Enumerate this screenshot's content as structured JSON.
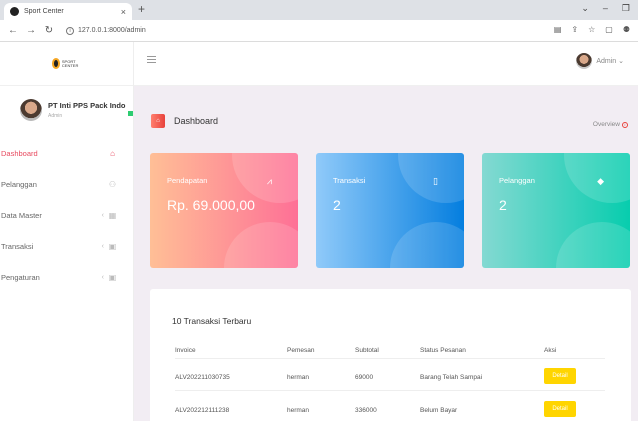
{
  "browser": {
    "tab_title": "Sport Center",
    "url": "127.0.0.1:8000/admin",
    "new_tab": "+",
    "tab_close": "×"
  },
  "sidebar": {
    "logo_text": "SPORT CENTER",
    "user_name": "PT Inti PPS Pack Indo",
    "user_role": "Admin",
    "items": [
      {
        "label": "Dashboard",
        "icon": "home-icon",
        "glyph": "⌂",
        "active": true
      },
      {
        "label": "Pelanggan",
        "icon": "users-icon",
        "glyph": "⚇",
        "active": false
      },
      {
        "label": "Data Master",
        "icon": "grid-icon",
        "glyph": "▦",
        "active": false
      },
      {
        "label": "Transaksi",
        "icon": "lock-icon",
        "glyph": "▣",
        "active": false
      },
      {
        "label": "Pengaturan",
        "icon": "lock-icon",
        "glyph": "▣",
        "active": false
      }
    ]
  },
  "topbar": {
    "admin_label": "Admin ⌄"
  },
  "page": {
    "title": "Dashboard",
    "overview": "Overview"
  },
  "cards": [
    {
      "label": "Pendapatan",
      "value": "Rp. 69.000,00",
      "icon": "chart-line-icon",
      "color_from": "#ffbf96",
      "color_to": "#fe7096"
    },
    {
      "label": "Transaksi",
      "value": "2",
      "icon": "bookmark-icon",
      "color_from": "#90caf9",
      "color_to": "#047edf"
    },
    {
      "label": "Pelanggan",
      "value": "2",
      "icon": "diamond-icon",
      "color_from": "#84d9d2",
      "color_to": "#07cdae"
    }
  ],
  "table": {
    "title": "10 Transaksi Terbaru",
    "headers": [
      "Invoice",
      "Pemesan",
      "Subtotal",
      "Status Pesanan",
      "Aksi"
    ],
    "rows": [
      {
        "invoice": "ALV202211030735",
        "pemesan": "herman",
        "subtotal": "69000",
        "status": "Barang Telah Sampai",
        "aksi": "Detail"
      },
      {
        "invoice": "ALV202212111238",
        "pemesan": "herman",
        "subtotal": "336000",
        "status": "Belum Bayar",
        "aksi": "Detail"
      }
    ]
  },
  "colors": {
    "accent": "#e84a5f",
    "detail_button": "#ffd500",
    "main_bg": "#f2edf3"
  }
}
